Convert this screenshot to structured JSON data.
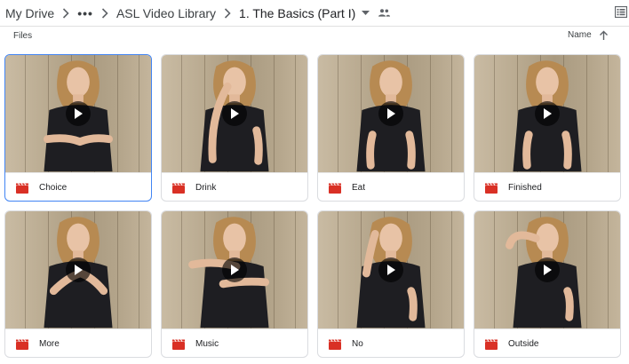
{
  "breadcrumb": {
    "root": "My Drive",
    "middle": "ASL Video Library",
    "current": "1. The Basics (Part I)"
  },
  "toolbar": {
    "section_label": "Files",
    "sort_label": "Name"
  },
  "files": [
    {
      "name": "Choice",
      "selected": true
    },
    {
      "name": "Drink",
      "selected": false
    },
    {
      "name": "Eat",
      "selected": false
    },
    {
      "name": "Finished",
      "selected": false
    },
    {
      "name": "More",
      "selected": false
    },
    {
      "name": "Music",
      "selected": false
    },
    {
      "name": "No",
      "selected": false
    },
    {
      "name": "Outside",
      "selected": false
    }
  ],
  "icons": {
    "file_type": "video-clapper-icon",
    "thumbnail_overlay": "play-icon",
    "shared_folder": "shared-folder-icon",
    "view_toggle": "list-view-icon",
    "sort_direction": "arrow-up-icon"
  },
  "colors": {
    "video_icon": "#d93025",
    "selection_border": "#4285f4"
  }
}
